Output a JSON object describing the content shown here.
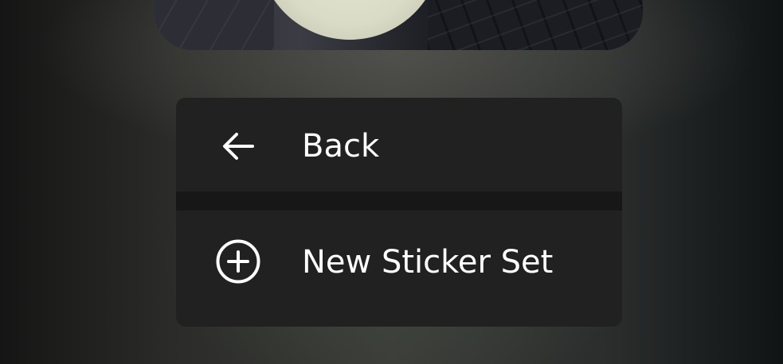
{
  "menu": {
    "items": [
      {
        "label": "Back",
        "icon": "arrow-left-icon"
      },
      {
        "label": "New Sticker Set",
        "icon": "plus-circle-icon"
      }
    ]
  },
  "colors": {
    "menu_background": "#212121",
    "divider": "#171717",
    "text": "#ffffff"
  }
}
